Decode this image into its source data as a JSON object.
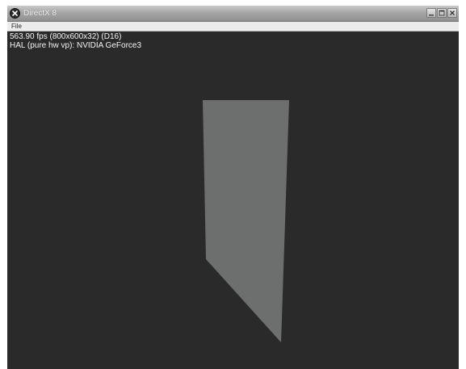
{
  "window": {
    "title": "DirectX 8",
    "menu": [
      {
        "label": "File"
      }
    ],
    "controls": [
      "minimize-icon",
      "maximize-icon",
      "close-icon"
    ]
  },
  "viewport": {
    "stats_line1": "563.90 fps (800x600x32) (D16)",
    "stats_line2": "HAL (pure hw vp): NVIDIA GeForce3"
  },
  "colors": {
    "background": "#2b2a2a",
    "shape_fill": "#6d6f6f",
    "stats_text": "#f4f4f4"
  }
}
